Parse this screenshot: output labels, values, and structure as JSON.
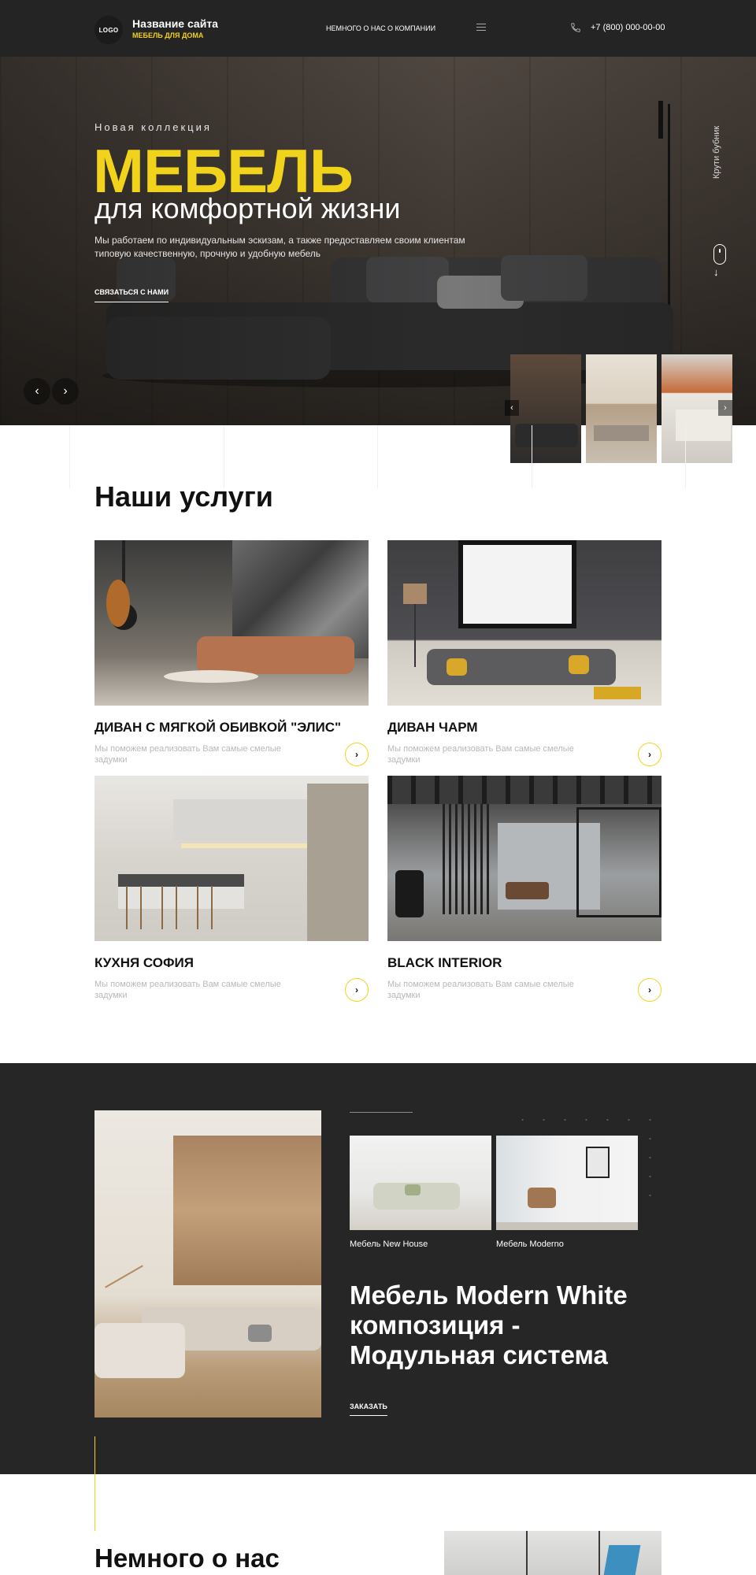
{
  "header": {
    "logo_text": "LOGO",
    "site_name": "Название сайта",
    "site_tagline": "МЕБЕЛЬ ДЛЯ ДОМА",
    "nav": [
      "НЕМНОГО О НАС",
      "О КОМПАНИИ"
    ],
    "menu_icon": "hamburger-icon",
    "phone_icon": "phone-icon",
    "phone": "+7 (800) 000-00-00"
  },
  "hero": {
    "subtitle": "Новая коллекция",
    "title": "МЕБЕЛЬ",
    "title2": "для комфортной жизни",
    "text": "Мы работаем по индивидуальным эскизам, а также предоставляем своим клиентам типовую качественную, прочную и удобную мебель",
    "link": "СВЯЗАТЬСЯ С НАМИ",
    "prev_icon": "chevron-left-icon",
    "next_icon": "chevron-right-icon",
    "scroll_hint": "Крути бубник",
    "accent_color": "#f2d31b"
  },
  "services": {
    "title": "Наши услуги",
    "cards": [
      {
        "title": "ДИВАН С МЯГКОЙ ОБИВКОЙ \"ЭЛИС\"",
        "desc": "Мы поможем реализовать Вам самые смелые задумки"
      },
      {
        "title": "ДИВАН ЧАРМ",
        "desc": "Мы поможем реализовать Вам самые смелые задумки"
      },
      {
        "title": "КУХНЯ СОФИЯ",
        "desc": "Мы поможем реализовать Вам самые смелые задумки"
      },
      {
        "title": "BLACK INTERIOR",
        "desc": "Мы поможем реализовать Вам самые смелые задумки"
      }
    ]
  },
  "featured": {
    "thumbs": [
      "Мебель New House",
      "Мебель Moderno"
    ],
    "title": "Мебель Modern White композиция - Модульная система",
    "order": "ЗАКАЗАТЬ"
  },
  "about": {
    "title": "Немного о нас"
  }
}
